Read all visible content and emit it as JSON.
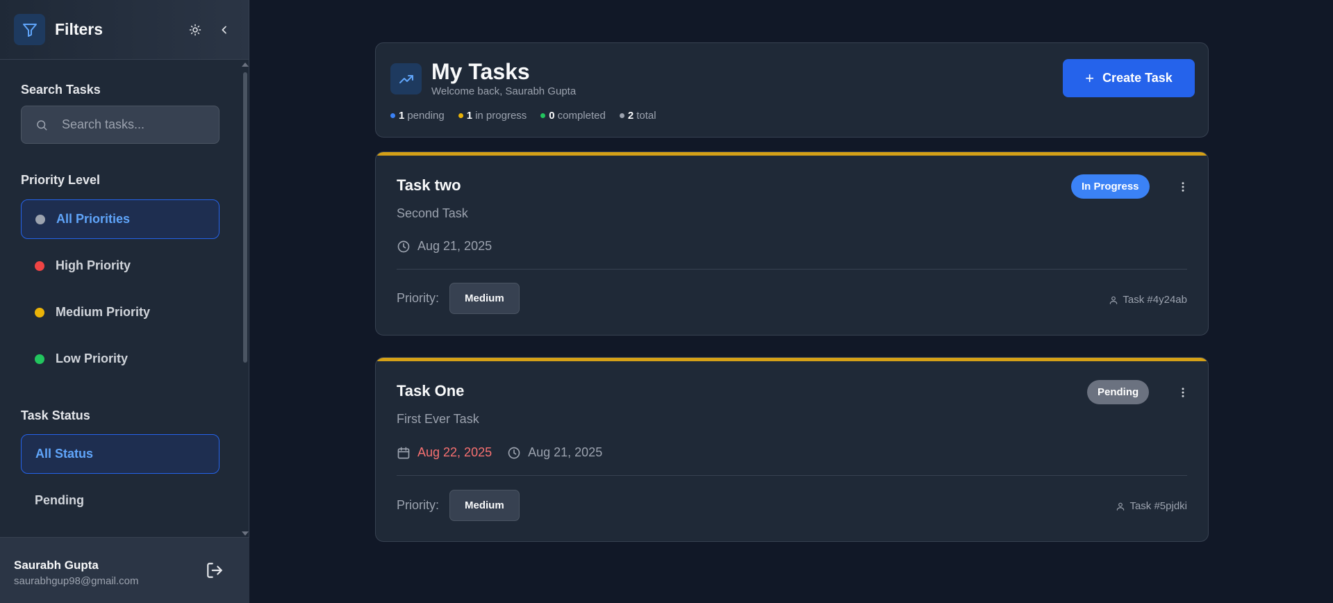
{
  "sidebar": {
    "title": "Filters",
    "search_label": "Search Tasks",
    "search_placeholder": "Search tasks...",
    "priority_label": "Priority Level",
    "priorities": [
      {
        "label": "All Priorities",
        "color": "#9ca3af",
        "active": true
      },
      {
        "label": "High Priority",
        "color": "#ef4444",
        "active": false
      },
      {
        "label": "Medium Priority",
        "color": "#eab308",
        "active": false
      },
      {
        "label": "Low Priority",
        "color": "#22c55e",
        "active": false
      }
    ],
    "status_label": "Task Status",
    "statuses": [
      {
        "label": "All Status",
        "active": true
      },
      {
        "label": "Pending",
        "active": false
      }
    ],
    "user": {
      "name": "Saurabh Gupta",
      "email": "saurabhgup98@gmail.com"
    }
  },
  "header": {
    "title": "My Tasks",
    "welcome": "Welcome back, Saurabh Gupta",
    "create_label": "Create Task",
    "stats": [
      {
        "count": "1",
        "label": "pending",
        "color": "#3b82f6"
      },
      {
        "count": "1",
        "label": "in progress",
        "color": "#eab308"
      },
      {
        "count": "0",
        "label": "completed",
        "color": "#22c55e"
      },
      {
        "count": "2",
        "label": "total",
        "color": "#9ca3af"
      }
    ]
  },
  "tasks": [
    {
      "title": "Task two",
      "description": "Second Task",
      "status": "In Progress",
      "updated": "Aug 21, 2025",
      "priority_label": "Priority:",
      "priority": "Medium",
      "task_id": "Task #4y24ab"
    },
    {
      "title": "Task One",
      "description": "First Ever Task",
      "status": "Pending",
      "due": "Aug 22, 2025",
      "updated": "Aug 21, 2025",
      "priority_label": "Priority:",
      "priority": "Medium",
      "task_id": "Task #5pjdki"
    }
  ],
  "colors": {
    "accent": "#2563eb",
    "task_bar": "#d4a017",
    "overdue": "#f87171"
  }
}
